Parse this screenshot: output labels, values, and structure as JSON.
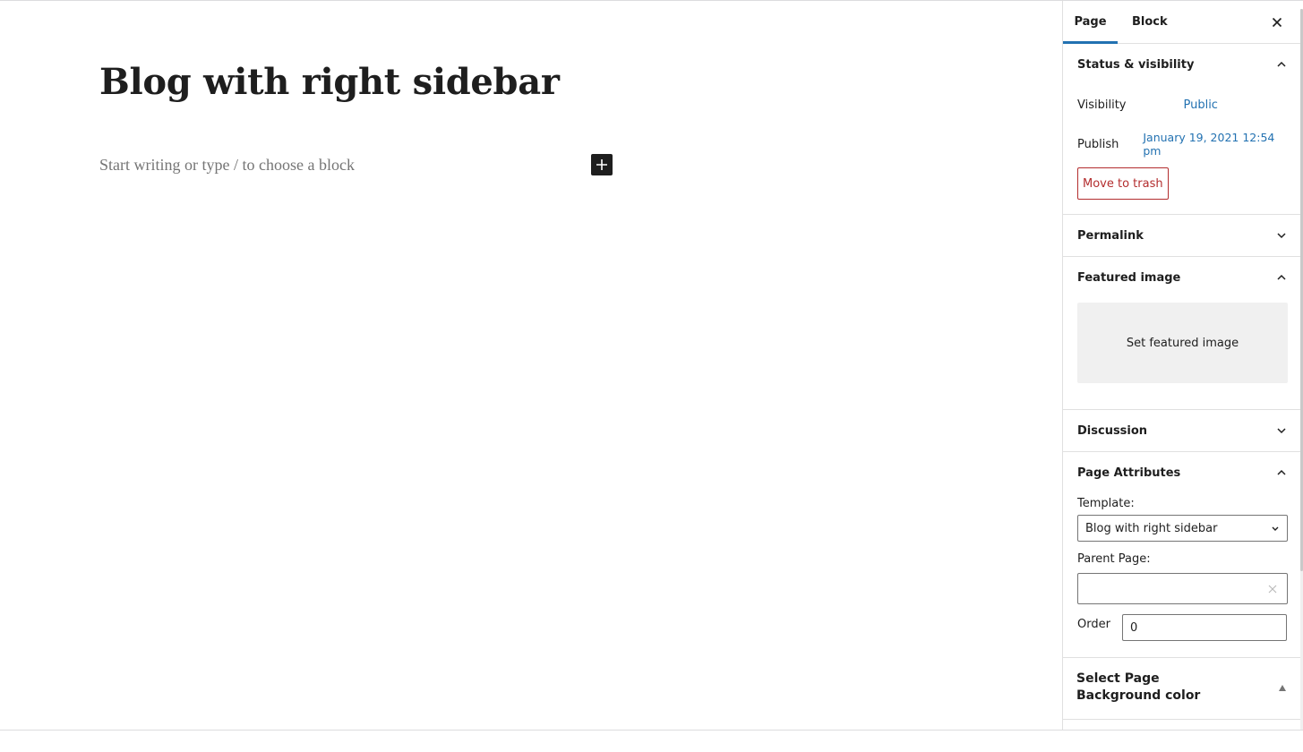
{
  "editor": {
    "title": "Blog with right sidebar",
    "placeholder": "Start writing or type / to choose a block",
    "inserter_icon": "plus-icon"
  },
  "sidebar": {
    "tabs": [
      {
        "label": "Page",
        "active": true
      },
      {
        "label": "Block",
        "active": false
      }
    ],
    "close_icon": "close-icon",
    "panels": {
      "status": {
        "title": "Status & visibility",
        "expanded": true,
        "visibility_label": "Visibility",
        "visibility_value": "Public",
        "publish_label": "Publish",
        "publish_value": "January 19, 2021 12:54 pm",
        "trash_label": "Move to trash"
      },
      "permalink": {
        "title": "Permalink",
        "expanded": false
      },
      "featured": {
        "title": "Featured image",
        "expanded": true,
        "button_label": "Set featured image"
      },
      "discussion": {
        "title": "Discussion",
        "expanded": false
      },
      "attributes": {
        "title": "Page Attributes",
        "expanded": true,
        "template_label": "Template:",
        "template_value": "Blog with right sidebar",
        "parent_label": "Parent Page:",
        "parent_value": "",
        "order_label": "Order",
        "order_value": "0"
      },
      "background": {
        "title": "Select Page Background color",
        "expanded": false
      }
    }
  },
  "colors": {
    "accent": "#2271b1",
    "danger": "#b32d2e",
    "text": "#1e1e1e",
    "placeholder": "#757575"
  }
}
